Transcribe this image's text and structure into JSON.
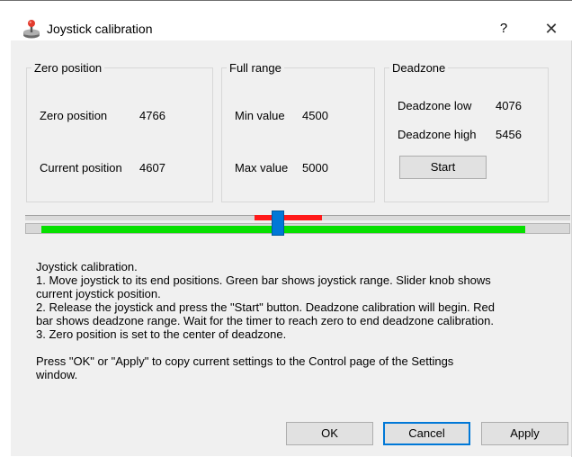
{
  "window": {
    "title": "Joystick calibration",
    "help_symbol": "?",
    "close_symbol": "✕",
    "icon": "joystick-icon"
  },
  "zero_group": {
    "legend": "Zero position",
    "zero_label": "Zero position",
    "zero_value": "4766",
    "current_label": "Current position",
    "current_value": "4607"
  },
  "range_group": {
    "legend": "Full range",
    "min_label": "Min value",
    "min_value": "4500",
    "max_label": "Max value",
    "max_value": "5000"
  },
  "deadzone_group": {
    "legend": "Deadzone",
    "low_label": "Deadzone low",
    "low_value": "4076",
    "high_label": "Deadzone high",
    "high_value": "5456",
    "start_label": "Start"
  },
  "gauge": {
    "deadzone_start_fraction": 0.42,
    "deadzone_end_fraction": 0.545,
    "range_start_fraction": 0.03,
    "range_end_fraction": 0.917,
    "knob_fraction": 0.463,
    "deadzone_color": "#ff1a1a",
    "range_color": "#06e000",
    "knob_color": "#0078d7"
  },
  "help_text": "Joystick calibration.\n1. Move joystick to its end positions. Green bar shows joystick range. Slider knob shows\ncurrent joystick position.\n2. Release the joystick and press the \"Start\" button. Deadzone calibration will begin. Red\nbar shows deadzone range. Wait for the timer to reach zero to end deadzone calibration.\n3. Zero position is set to the center of deadzone.\n\nPress \"OK\" or \"Apply\" to copy current settings to the Control page of the Settings\nwindow.",
  "buttons": {
    "ok": "OK",
    "cancel": "Cancel",
    "apply": "Apply"
  }
}
